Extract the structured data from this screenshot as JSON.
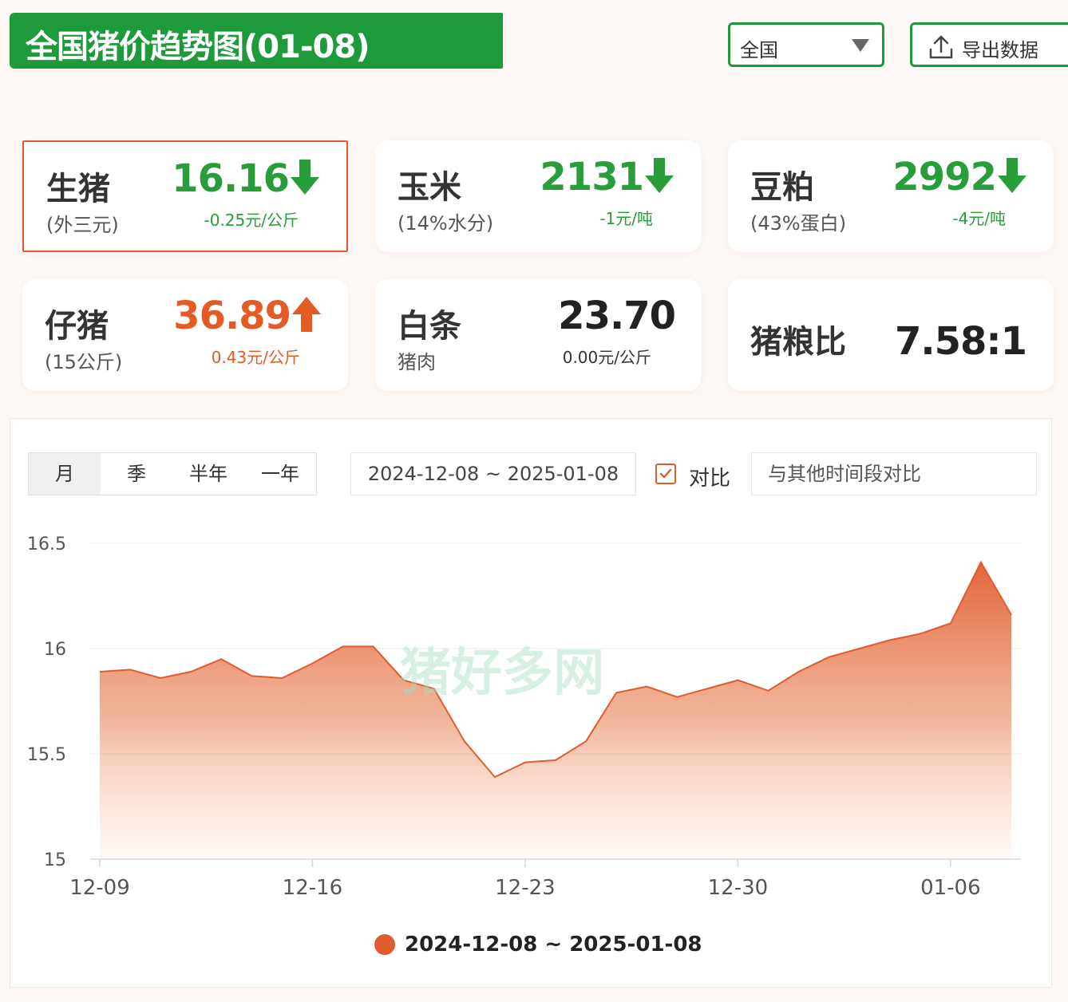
{
  "header": {
    "title": "全国猪价趋势图(01-08)",
    "region_select": {
      "value": "全国"
    },
    "export_label": "导出数据"
  },
  "cards": [
    {
      "name": "生猪",
      "sub": "(外三元)",
      "value": "16.16",
      "change": "-0.25元/公斤",
      "trend": "down"
    },
    {
      "name": "玉米",
      "sub": "(14%水分)",
      "value": "2131",
      "change": "-1元/吨",
      "trend": "down"
    },
    {
      "name": "豆粕",
      "sub": "(43%蛋白)",
      "value": "2992",
      "change": "-4元/吨",
      "trend": "down"
    },
    {
      "name": "仔猪",
      "sub": "(15公斤)",
      "value": "36.89",
      "change": "0.43元/公斤",
      "trend": "up"
    },
    {
      "name": "白条",
      "sub": "猪肉",
      "value": "23.70",
      "change": "0.00元/公斤",
      "trend": "flat"
    },
    {
      "name": "猪粮比",
      "value": "7.58:1"
    }
  ],
  "chart_controls": {
    "period_tabs": [
      "月",
      "季",
      "半年",
      "一年"
    ],
    "active_period": "月",
    "date_range": "2024-12-08 ~ 2025-01-08",
    "compare_checked": true,
    "compare_label": "对比",
    "compare_placeholder": "与其他时间段对比"
  },
  "colors": {
    "brand_green": "#1f9a3b",
    "down_green": "#2a9d3b",
    "up_orange": "#e65a24",
    "series": "#e05c2f"
  },
  "chart_data": {
    "type": "area",
    "title": "",
    "xlabel": "",
    "ylabel": "",
    "ylim": [
      15,
      16.5
    ],
    "yticks": [
      "16.5",
      "16",
      "15.5",
      "15"
    ],
    "xticks": [
      "12-09",
      "12-16",
      "12-23",
      "12-30",
      "01-06"
    ],
    "x": [
      "12-09",
      "12-10",
      "12-11",
      "12-12",
      "12-13",
      "12-14",
      "12-15",
      "12-16",
      "12-17",
      "12-18",
      "12-19",
      "12-20",
      "12-21",
      "12-22",
      "12-23",
      "12-24",
      "12-25",
      "12-26",
      "12-27",
      "12-28",
      "12-29",
      "12-30",
      "12-31",
      "01-01",
      "01-02",
      "01-03",
      "01-04",
      "01-05",
      "01-06",
      "01-07",
      "01-08"
    ],
    "series": [
      {
        "name": "2024-12-08 ~ 2025-01-08",
        "values": [
          15.89,
          15.9,
          15.86,
          15.89,
          15.95,
          15.87,
          15.86,
          15.93,
          16.01,
          16.01,
          15.85,
          15.81,
          15.56,
          15.39,
          15.46,
          15.47,
          15.56,
          15.79,
          15.82,
          15.77,
          15.81,
          15.85,
          15.8,
          15.89,
          15.96,
          16.0,
          16.04,
          16.07,
          16.12,
          16.41,
          16.16
        ]
      }
    ],
    "legend": "bottom-center",
    "grid": true,
    "watermark": "猪好多网"
  }
}
